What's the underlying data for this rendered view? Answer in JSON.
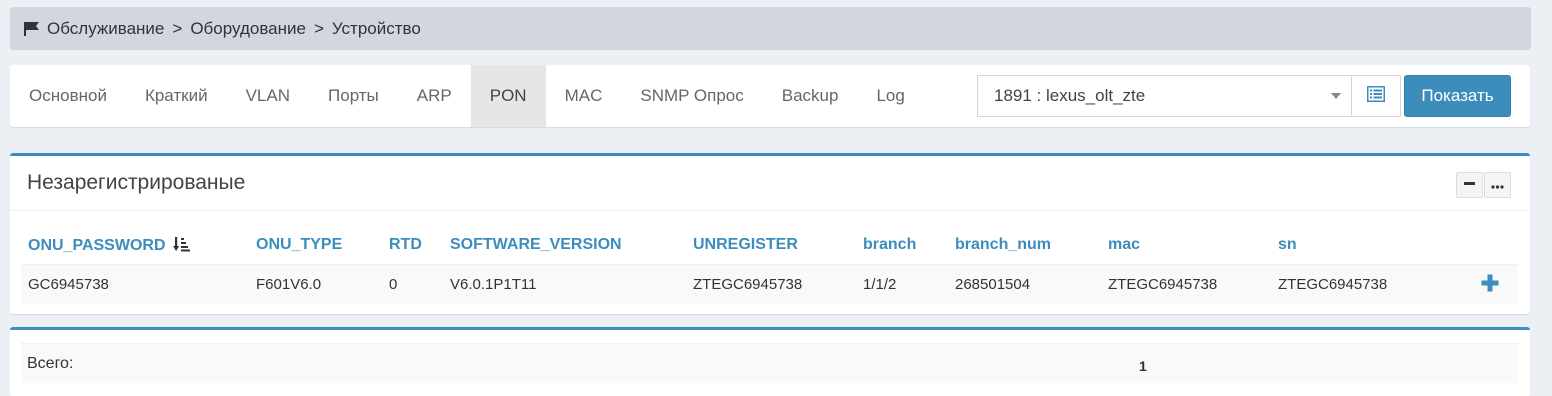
{
  "breadcrumb": {
    "icon": "flag-icon",
    "items": [
      "Обслуживание",
      "Оборудование",
      "Устройство"
    ],
    "separator": ">"
  },
  "tabs": [
    {
      "label": "Основной",
      "active": false
    },
    {
      "label": "Краткий",
      "active": false
    },
    {
      "label": "VLAN",
      "active": false
    },
    {
      "label": "Порты",
      "active": false
    },
    {
      "label": "ARP",
      "active": false
    },
    {
      "label": "PON",
      "active": true
    },
    {
      "label": "MAC",
      "active": false
    },
    {
      "label": "SNMP Опрос",
      "active": false
    },
    {
      "label": "Backup",
      "active": false
    },
    {
      "label": "Log",
      "active": false
    }
  ],
  "device_select": {
    "value": "1891 : lexus_olt_zte"
  },
  "list_button": {
    "icon": "list-icon"
  },
  "show_button": {
    "label": "Показать"
  },
  "unregistered": {
    "title": "Незарегистрированые",
    "columns": [
      "ONU_PASSWORD",
      "ONU_TYPE",
      "RTD",
      "SOFTWARE_VERSION",
      "UNREGISTER",
      "branch",
      "branch_num",
      "mac",
      "sn"
    ],
    "sort_icon": "sort-amount-down-icon",
    "rows": [
      [
        "GC6945738",
        "F601V6.0",
        "0",
        "V6.0.1P1T11",
        "ZTEGC6945738",
        "1/1/2",
        "268501504",
        "ZTEGC6945738",
        "ZTEGC6945738"
      ]
    ],
    "row_action_icon": "plus-icon"
  },
  "summary": {
    "label": "Всего:",
    "value": "1"
  },
  "colors": {
    "accent": "#3c8dbc",
    "breadcrumb_bg": "#d2d6de",
    "page_bg": "#ecf0f5"
  }
}
